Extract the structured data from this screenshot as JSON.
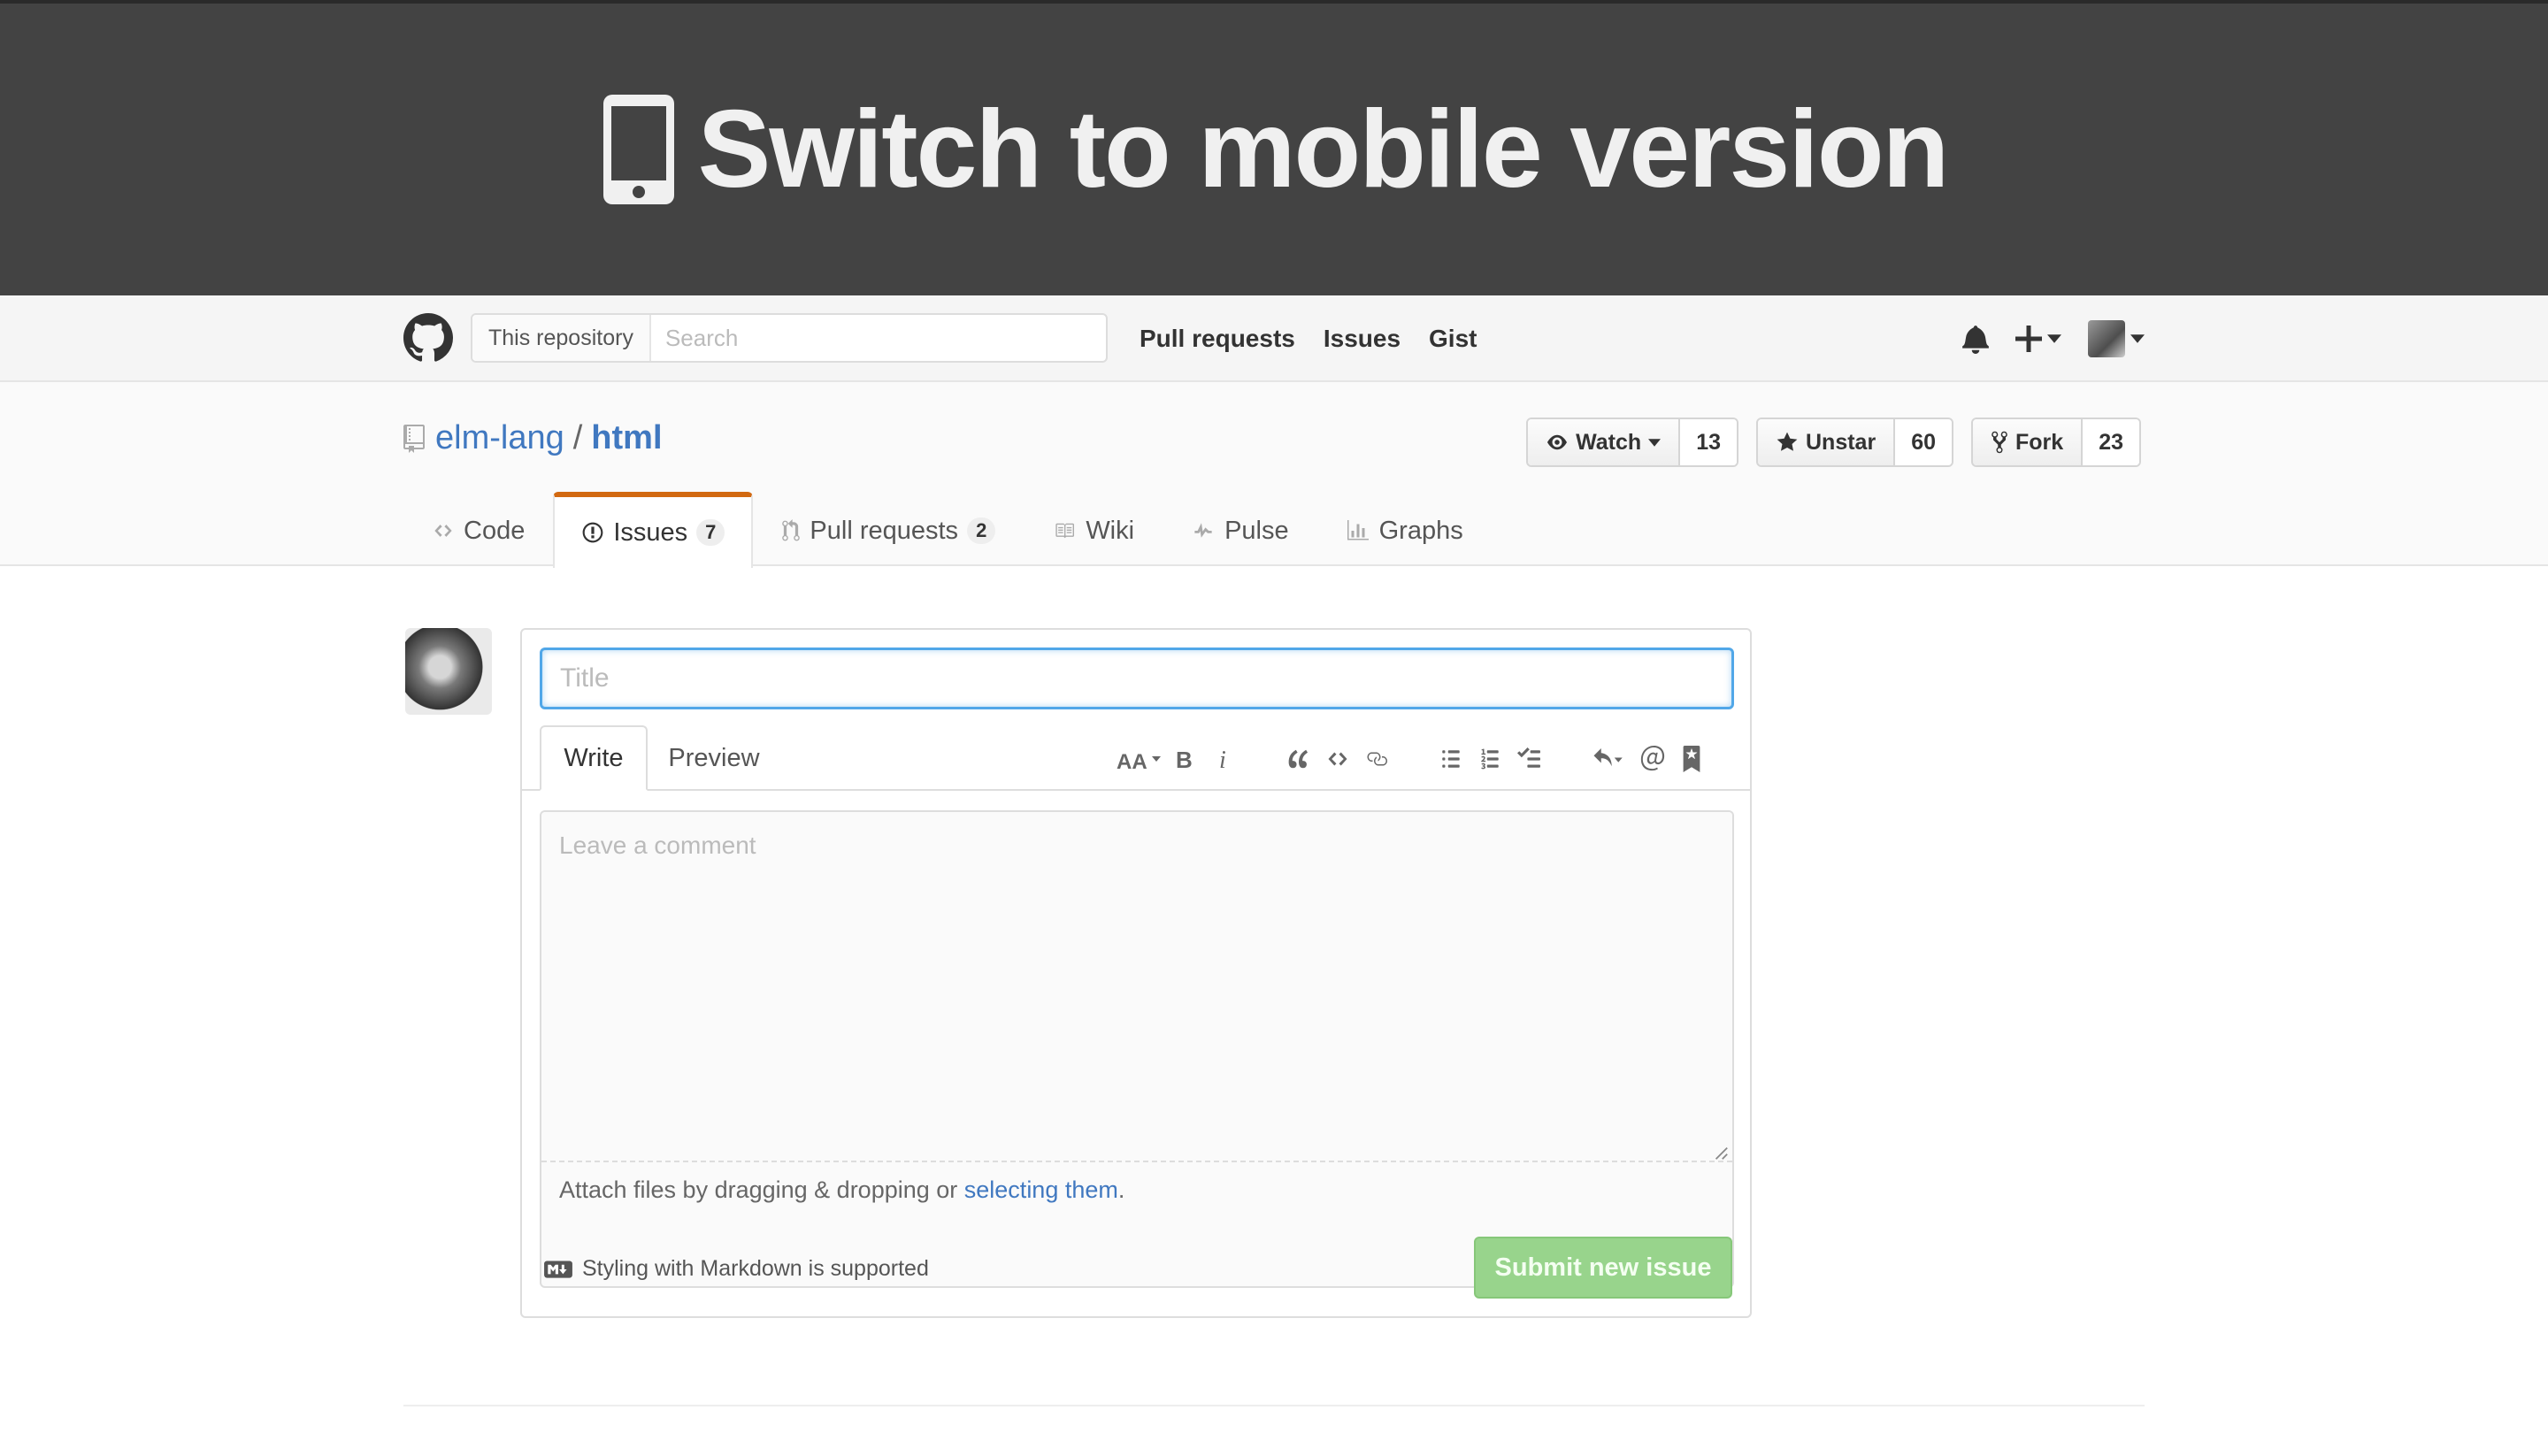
{
  "banner": {
    "text": "Switch to mobile version",
    "icon": "mobile-phone-icon"
  },
  "header": {
    "search_scope": "This repository",
    "search_placeholder": "Search",
    "nav": [
      "Pull requests",
      "Issues",
      "Gist"
    ]
  },
  "repo": {
    "owner": "elm-lang",
    "separator": "/",
    "name": "html",
    "actions": {
      "watch": {
        "label": "Watch",
        "count": "13"
      },
      "star": {
        "label": "Unstar",
        "count": "60"
      },
      "fork": {
        "label": "Fork",
        "count": "23"
      }
    },
    "tabs": [
      {
        "label": "Code"
      },
      {
        "label": "Issues",
        "count": "7"
      },
      {
        "label": "Pull requests",
        "count": "2"
      },
      {
        "label": "Wiki"
      },
      {
        "label": "Pulse"
      },
      {
        "label": "Graphs"
      }
    ]
  },
  "form": {
    "title_placeholder": "Title",
    "write_tab": "Write",
    "preview_tab": "Preview",
    "comment_placeholder": "Leave a comment",
    "attach_text": "Attach files by dragging & dropping or ",
    "attach_link": "selecting them",
    "attach_end": ".",
    "markdown_note": "Styling with Markdown is supported",
    "submit_label": "Submit new issue"
  },
  "colors": {
    "accent_tab": "#d26911",
    "link": "#4078c0",
    "submit_disabled": "#98d48c",
    "banner_bg": "#434343"
  }
}
